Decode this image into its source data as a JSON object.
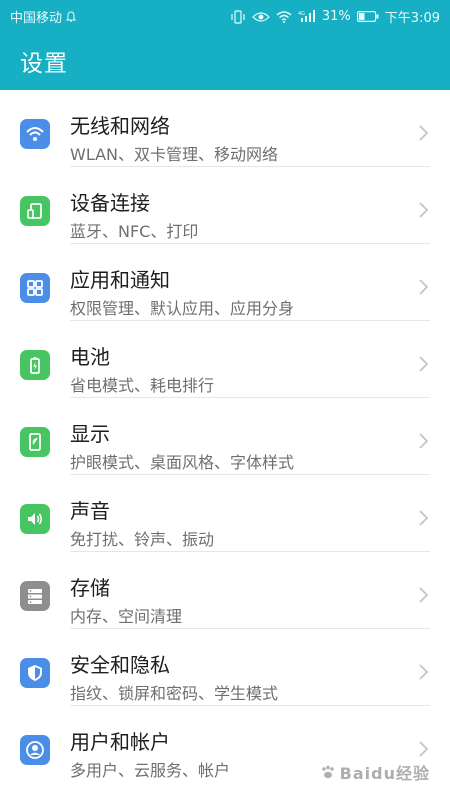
{
  "status_bar": {
    "carrier": "中国移动",
    "battery": "31%",
    "time": "下午3:09"
  },
  "header": {
    "title": "设置"
  },
  "colors": {
    "header_bg": "#16afc4",
    "icon_blue": "#4a8ee8",
    "icon_green": "#47c562",
    "icon_gray": "#8e8e8e"
  },
  "settings": [
    {
      "title": "无线和网络",
      "subtitle": "WLAN、双卡管理、移动网络",
      "icon": "wifi-icon"
    },
    {
      "title": "设备连接",
      "subtitle": "蓝牙、NFC、打印",
      "icon": "device-connection-icon"
    },
    {
      "title": "应用和通知",
      "subtitle": "权限管理、默认应用、应用分身",
      "icon": "apps-grid-icon"
    },
    {
      "title": "电池",
      "subtitle": "省电模式、耗电排行",
      "icon": "battery-icon"
    },
    {
      "title": "显示",
      "subtitle": "护眼模式、桌面风格、字体样式",
      "icon": "display-icon"
    },
    {
      "title": "声音",
      "subtitle": "免打扰、铃声、振动",
      "icon": "sound-icon"
    },
    {
      "title": "存储",
      "subtitle": "内存、空间清理",
      "icon": "storage-icon"
    },
    {
      "title": "安全和隐私",
      "subtitle": "指纹、锁屏和密码、学生模式",
      "icon": "shield-icon"
    },
    {
      "title": "用户和帐户",
      "subtitle": "多用户、云服务、帐户",
      "icon": "user-icon"
    }
  ],
  "watermark": "Baidu经验"
}
